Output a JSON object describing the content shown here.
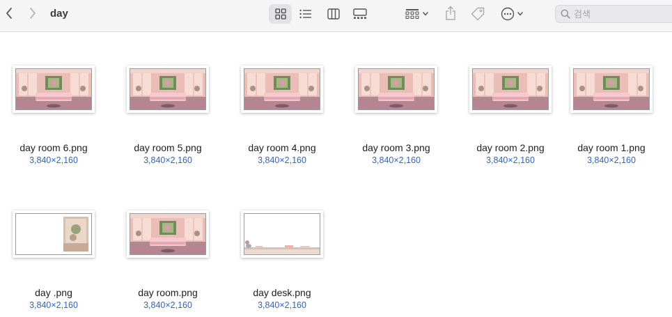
{
  "window": {
    "title": "day"
  },
  "toolbar": {
    "icons": [
      "chevron-left-icon",
      "chevron-right-icon",
      "icon-grid-icon",
      "list-icon",
      "columns-icon",
      "gallery-icon",
      "group-grid-icon",
      "chevron-down-icon",
      "share-icon",
      "tag-icon",
      "ellipsis-circle-icon",
      "magnifier-icon"
    ],
    "active_view": "icon-grid"
  },
  "search": {
    "placeholder": "검색",
    "value": ""
  },
  "files": [
    {
      "name": "day room 6.png",
      "dims": "3,840×2,160",
      "preview": "room"
    },
    {
      "name": "day room 5.png",
      "dims": "3,840×2,160",
      "preview": "room"
    },
    {
      "name": "day room 4.png",
      "dims": "3,840×2,160",
      "preview": "room"
    },
    {
      "name": "day room 3.png",
      "dims": "3,840×2,160",
      "preview": "room"
    },
    {
      "name": "day room 2.png",
      "dims": "3,840×2,160",
      "preview": "room"
    },
    {
      "name": "day room 1.png",
      "dims": "3,840×2,160",
      "preview": "room"
    },
    {
      "name": "day .png",
      "dims": "3,840×2,160",
      "preview": "window"
    },
    {
      "name": "day room.png",
      "dims": "3,840×2,160",
      "preview": "room"
    },
    {
      "name": "day desk.png",
      "dims": "3,840×2,160",
      "preview": "desk"
    }
  ],
  "colors": {
    "accent_dims": "#2a66c4",
    "toolbar_bg": "#f6f5f6",
    "selected_view_bg": "#e3e2e4"
  }
}
